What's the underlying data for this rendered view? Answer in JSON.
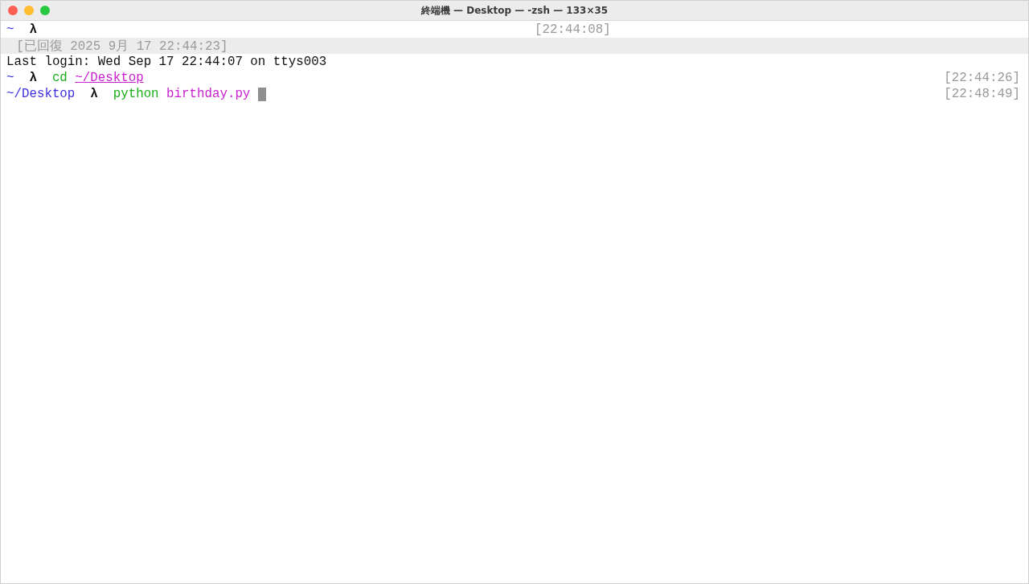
{
  "window": {
    "title": "終端機 — Desktop — -zsh — 133×35"
  },
  "lines": [
    {
      "kind": "normal",
      "segments": [
        {
          "text": "~",
          "kind": "dir"
        },
        {
          "text": "λ",
          "kind": "prompt"
        }
      ],
      "timestamp": {
        "text": "[22:44:08]",
        "kind": "mid"
      }
    },
    {
      "kind": "banner",
      "segments": [
        {
          "text": "[已回復 2025 9月 17 22:44:23]",
          "kind": "muted"
        }
      ]
    },
    {
      "kind": "normal",
      "segments": [
        {
          "text": "Last login: Wed Sep 17 22:44:07 on ttys003",
          "kind": "plain"
        }
      ]
    },
    {
      "kind": "normal",
      "segments": [
        {
          "text": "~",
          "kind": "dir"
        },
        {
          "text": "λ",
          "kind": "prompt"
        },
        {
          "text": "cd",
          "kind": "command"
        },
        {
          "text": "~/Desktop",
          "kind": "path"
        }
      ],
      "timestamp": {
        "text": "[22:44:26]",
        "kind": "right"
      }
    },
    {
      "kind": "normal",
      "segments": [
        {
          "text": "~/Desktop",
          "kind": "dir"
        },
        {
          "text": "λ",
          "kind": "prompt"
        },
        {
          "text": "python",
          "kind": "command"
        },
        {
          "text": "birthday.py",
          "kind": "argument"
        }
      ],
      "timestamp": {
        "text": "[22:48:49]",
        "kind": "right"
      },
      "cursor": true
    }
  ]
}
